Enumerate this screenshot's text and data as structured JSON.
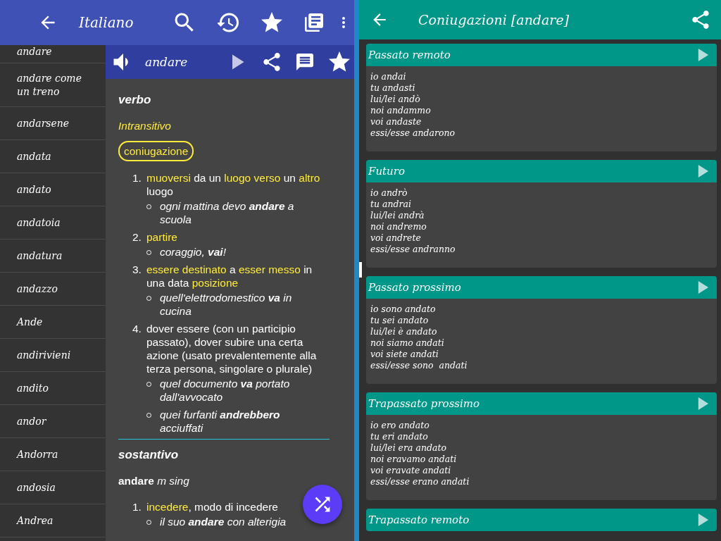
{
  "app_bar": {
    "title": "Italiano"
  },
  "word_list": [
    {
      "word": "andare"
    },
    {
      "word": "andare come un treno"
    },
    {
      "word": "andarsene"
    },
    {
      "word": "andata"
    },
    {
      "word": "andato"
    },
    {
      "word": "andatoia"
    },
    {
      "word": "andatura"
    },
    {
      "word": "andazzo"
    },
    {
      "word": "Ande"
    },
    {
      "word": "andirivieni"
    },
    {
      "word": "andito"
    },
    {
      "word": "andor"
    },
    {
      "word": "Andorra"
    },
    {
      "word": "andosia"
    },
    {
      "word": "Andrea"
    }
  ],
  "entry": {
    "word": "andare",
    "sections": [
      {
        "pos": "verbo",
        "subtype": "Intransitivo",
        "chip": "coniugazione",
        "definitions": [
          {
            "number": "1.",
            "segments": [
              {
                "kind": "link",
                "text": "muoversi"
              },
              {
                "kind": "plain",
                "text": " da un "
              },
              {
                "kind": "link",
                "text": "luogo verso"
              },
              {
                "kind": "plain",
                "text": " un "
              },
              {
                "kind": "link",
                "text": "altro"
              },
              {
                "kind": "plain",
                "text": " luogo"
              }
            ],
            "examples": [
              "ogni mattina devo **andare** a scuola"
            ]
          },
          {
            "number": "2.",
            "segments": [
              {
                "kind": "link",
                "text": "partire"
              }
            ],
            "examples": [
              "coraggio, **vai**!"
            ]
          },
          {
            "number": "3.",
            "segments": [
              {
                "kind": "link",
                "text": "essere destinato"
              },
              {
                "kind": "plain",
                "text": " a "
              },
              {
                "kind": "link",
                "text": "esser messo"
              },
              {
                "kind": "plain",
                "text": " in una data "
              },
              {
                "kind": "link",
                "text": "posizione"
              }
            ],
            "examples": [
              "quell'elettrodomestico **va** in cucina"
            ]
          },
          {
            "number": "4.",
            "segments": [
              {
                "kind": "plain",
                "text": "dover essere (con un participio passato), dover subire una certa azione (usato prevalentemente alla terza persona, singolare o plurale)"
              }
            ],
            "examples": [
              "quel documento **va** portato dall'avvocato",
              "quei furfanti **andrebbero** acciuffati"
            ]
          }
        ]
      },
      {
        "pos": "sostantivo",
        "headword": "**andare** *m sing*",
        "definitions": [
          {
            "number": "1.",
            "segments": [
              {
                "kind": "link",
                "text": "incedere"
              },
              {
                "kind": "plain",
                "text": ", modo di incedere"
              }
            ],
            "examples": [
              "il suo **andare** con alterigia"
            ]
          }
        ]
      }
    ]
  },
  "conjugation_panel": {
    "title": "Coniugazioni [andare]",
    "tenses": [
      {
        "name": "Passato remoto",
        "forms": [
          "io andai",
          "tu andasti",
          "lui/lei andò",
          "noi andammo",
          "voi andaste",
          "essi/esse andarono"
        ]
      },
      {
        "name": "Futuro",
        "forms": [
          "io andrò",
          "tu andrai",
          "lui/lei andrà",
          "noi andremo",
          "voi andrete",
          "essi/esse andranno"
        ]
      },
      {
        "name": "Passato prossimo",
        "forms": [
          "io sono andato",
          "tu sei andato",
          "lui/lei è andato",
          "noi siamo andati",
          "voi siete andati",
          "essi/esse sono  andati"
        ]
      },
      {
        "name": "Trapassato prossimo",
        "forms": [
          "io ero andato",
          "tu eri andato",
          "lui/lei era andato",
          "noi eravamo andati",
          "voi eravate andati",
          "essi/esse erano andati"
        ]
      },
      {
        "name": "Trapassato remoto"
      }
    ]
  }
}
